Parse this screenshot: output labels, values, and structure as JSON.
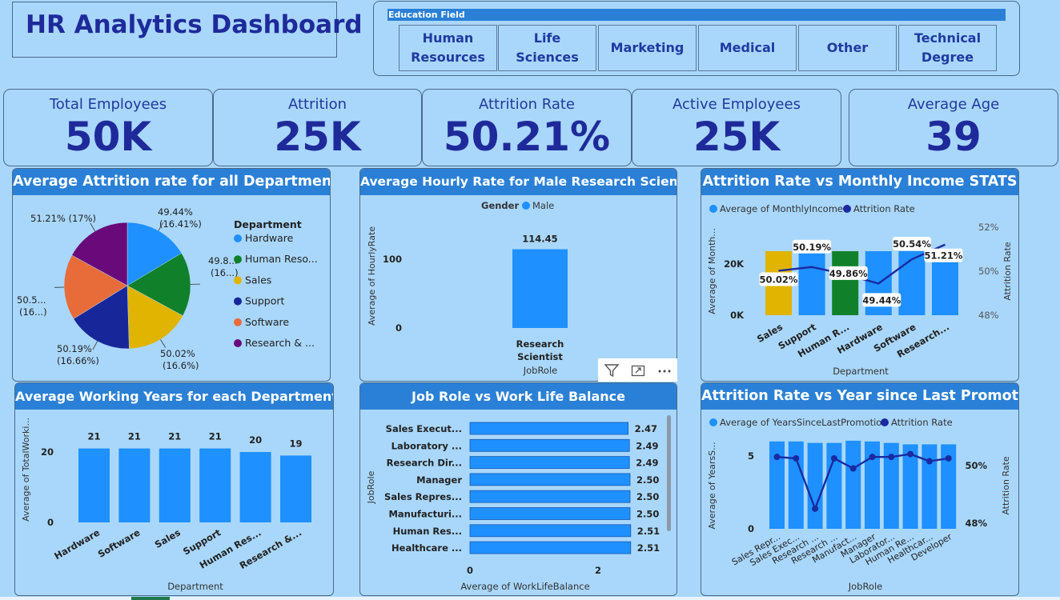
{
  "header": {
    "title": "HR Analytics Dashboard"
  },
  "slicer": {
    "title": "Education Field",
    "options": [
      {
        "line1": "Human",
        "line2": "Resources"
      },
      {
        "line1": "Life",
        "line2": "Sciences"
      },
      {
        "line1": "Marketing",
        "line2": ""
      },
      {
        "line1": "Medical",
        "line2": ""
      },
      {
        "line1": "Other",
        "line2": ""
      },
      {
        "line1": "Technical",
        "line2": "Degree"
      }
    ]
  },
  "kpis": [
    {
      "label": "Total Employees",
      "value": "50K"
    },
    {
      "label": "Attrition",
      "value": "25K"
    },
    {
      "label": "Attrition Rate",
      "value": "50.21%"
    },
    {
      "label": "Active Employees",
      "value": "25K"
    },
    {
      "label": "Average Age",
      "value": "39"
    }
  ],
  "colors": {
    "bar": "#1e90ff",
    "line": "#1a2aa0",
    "header": "#2a80d6",
    "background": "#a9d7fb"
  },
  "chart_data": [
    {
      "type": "pie",
      "title": "Average Attrition rate for all Departments",
      "legend_title": "Department",
      "legend_position": "right",
      "slices": [
        {
          "name": "Hardware",
          "legend": "Hardware",
          "value": 16.41,
          "label1": "49.44%",
          "label2": "(16.41%)",
          "color": "#1e90ff"
        },
        {
          "name": "Human Resources",
          "legend": "Human Reso...",
          "value": 16.5,
          "label1": "49.8...",
          "label2": "(16...)",
          "color": "#11802a"
        },
        {
          "name": "Sales",
          "legend": "Sales",
          "value": 16.6,
          "label1": "50.02%",
          "label2": "(16.6%)",
          "color": "#e0b400"
        },
        {
          "name": "Support",
          "legend": "Support",
          "value": 16.66,
          "label1": "50.19%",
          "label2": "(16.66%)",
          "color": "#17279a"
        },
        {
          "name": "Software",
          "legend": "Software",
          "value": 16.8,
          "label1": "50.5...",
          "label2": "(16...)",
          "color": "#e86c3a"
        },
        {
          "name": "Research & Development",
          "legend": "Research & ...",
          "value": 17,
          "label1": "51.21% (17%)",
          "label2": "",
          "color": "#6a0a7a"
        }
      ]
    },
    {
      "type": "bar",
      "title": "Average Hourly Rate for Male Research Scientist",
      "legend_title": "Gender",
      "legend": [
        "Male"
      ],
      "categories": [
        "Research Scientist"
      ],
      "category_lines": [
        [
          "Research",
          "Scientist"
        ]
      ],
      "values": [
        114.45
      ],
      "value_labels": [
        "114.45"
      ],
      "xlabel": "JobRole",
      "ylabel": "Average of HourlyRate",
      "yticks": [
        0,
        100
      ],
      "ylim": [
        0,
        130
      ]
    },
    {
      "type": "bar+line",
      "title": "Attrition Rate vs Monthly Income STATS",
      "legend": [
        "Average of MonthlyIncome",
        "Attrition Rate"
      ],
      "categories": [
        "Sales",
        "Support",
        "Human R...",
        "Hardware",
        "Software",
        "Research..."
      ],
      "bar_values": [
        25000,
        25000,
        25000,
        25000,
        25000,
        25000
      ],
      "bar_colors": [
        "#e0b400",
        "#1e90ff",
        "#11802a",
        "#1e90ff",
        "#1e90ff",
        "#1e90ff"
      ],
      "line_values": [
        50.02,
        50.19,
        49.86,
        49.44,
        50.54,
        51.21
      ],
      "line_labels": [
        "50.02%",
        "50.19%",
        "49.86%",
        "49.44%",
        "50.54%",
        "51.21%"
      ],
      "xlabel": "Department",
      "ylabel": "Average of Month...",
      "y2label": "Attrition Rate",
      "yticks": [
        "0K",
        "20K"
      ],
      "y2ticks": [
        "48%",
        "50%",
        "52%"
      ],
      "ylim": [
        0,
        35000
      ],
      "y2lim": [
        48,
        52
      ]
    },
    {
      "type": "bar",
      "title": "Average Working Years for each Department",
      "categories": [
        "Hardware",
        "Software",
        "Sales",
        "Support",
        "Human Res...",
        "Research &..."
      ],
      "values": [
        21,
        21,
        21,
        21,
        20,
        19
      ],
      "value_labels": [
        "21",
        "21",
        "21",
        "21",
        "20",
        "19"
      ],
      "xlabel": "Department",
      "ylabel": "Average of TotalWorki...",
      "yticks": [
        0,
        20
      ],
      "ylim": [
        0,
        25
      ]
    },
    {
      "type": "hbar",
      "title": "Job Role vs Work Life Balance",
      "categories": [
        "Sales Execut...",
        "Laboratory ...",
        "Research Dir...",
        "Manager",
        "Sales Repres...",
        "Manufacturi...",
        "Human Res...",
        "Healthcare ..."
      ],
      "values": [
        2.47,
        2.49,
        2.49,
        2.5,
        2.5,
        2.5,
        2.51,
        2.51
      ],
      "value_labels": [
        "2.47",
        "2.49",
        "2.49",
        "2.50",
        "2.50",
        "2.50",
        "2.51",
        "2.51"
      ],
      "xlabel": "Average of WorkLifeBalance",
      "ylabel": "JobRole",
      "xticks": [
        0,
        2
      ],
      "xlim": [
        0,
        3
      ]
    },
    {
      "type": "bar+line",
      "title": "Attrition Rate vs Year since Last Promotion",
      "legend": [
        "Average of YearsSinceLastPromotion",
        "Attrition Rate"
      ],
      "categories": [
        "Sales Repr...",
        "Sales Exec...",
        "Research ...",
        "Research ...",
        "Manufact...",
        "Manager",
        "Laborator...",
        "Human Re...",
        "Healthcar...",
        "Developer"
      ],
      "bar_values": [
        6.0,
        6.0,
        5.9,
        5.9,
        6.05,
        6.0,
        5.9,
        5.8,
        5.8,
        5.8
      ],
      "line_values": [
        50.3,
        50.25,
        48.5,
        50.25,
        49.9,
        50.3,
        50.3,
        50.4,
        50.15,
        50.25
      ],
      "xlabel": "JobRole",
      "ylabel": "Average of YearsS...",
      "y2label": "Attrition Rate",
      "yticks": [
        0,
        5
      ],
      "y2ticks": [
        "48%",
        "50%"
      ],
      "ylim": [
        0,
        7
      ],
      "y2lim": [
        47.8,
        51
      ]
    }
  ]
}
